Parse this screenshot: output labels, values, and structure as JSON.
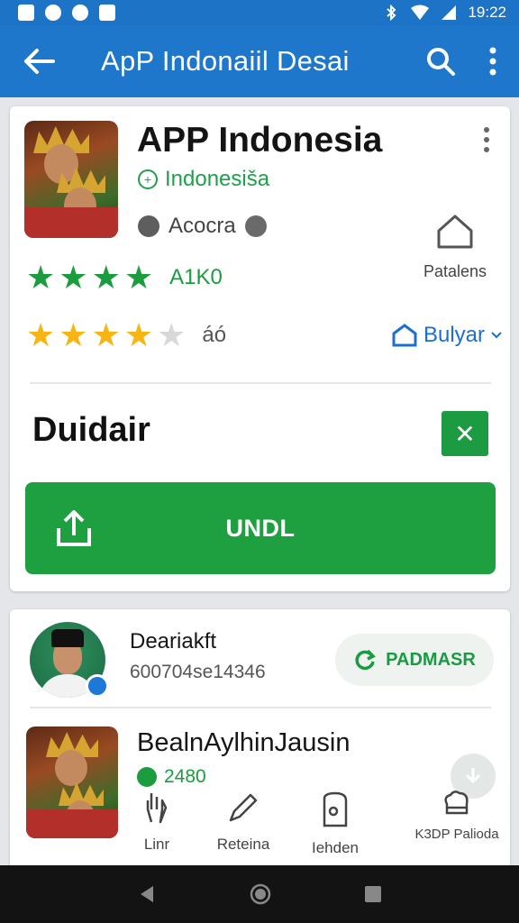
{
  "status_bar": {
    "time": "19:22"
  },
  "app_bar": {
    "title": "ApP  Indonaiil Desai"
  },
  "app": {
    "name": "APP Indonesia",
    "developer": "Indonesiša",
    "category": "Acocra",
    "home_label": "Patalens",
    "rating_score": "A1K0",
    "rating_count": "áó",
    "rating_stars": 4,
    "sort_label": "Bulyar",
    "section_title": "Duidair",
    "install_label": "UNDL"
  },
  "developer": {
    "name": "Deariakft",
    "id": "600704se14346",
    "follow_label": "PADMASR"
  },
  "related_app": {
    "name": "BealnAylhinJausin",
    "downloads": "2480",
    "actions": [
      {
        "label": "Linr",
        "icon": "hand-icon"
      },
      {
        "label": "Reteina",
        "icon": "pen-icon"
      },
      {
        "label": "Iehden",
        "icon": "lock-icon"
      },
      {
        "label": "K3DP Palioda",
        "icon": "chef-hat-icon"
      }
    ]
  },
  "colors": {
    "primary": "#1e77cb",
    "accent_green": "#1ea040",
    "star_yellow": "#f6b512"
  }
}
